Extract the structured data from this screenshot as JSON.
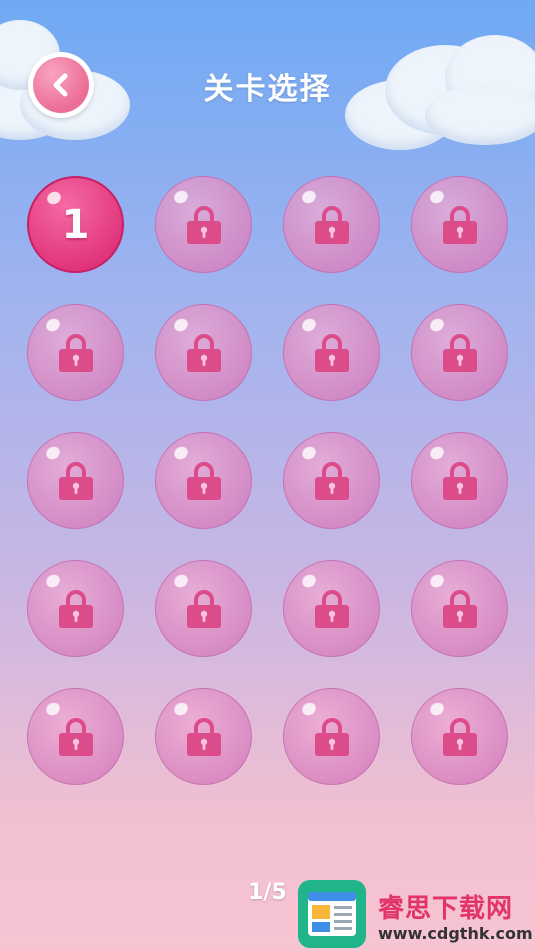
{
  "header": {
    "title": "关卡选择",
    "back_icon": "chevron-left-icon"
  },
  "levels": [
    {
      "label": "1",
      "state": "unlocked"
    },
    {
      "label": "",
      "state": "locked"
    },
    {
      "label": "",
      "state": "locked"
    },
    {
      "label": "",
      "state": "locked"
    },
    {
      "label": "",
      "state": "locked"
    },
    {
      "label": "",
      "state": "locked"
    },
    {
      "label": "",
      "state": "locked"
    },
    {
      "label": "",
      "state": "locked"
    },
    {
      "label": "",
      "state": "locked"
    },
    {
      "label": "",
      "state": "locked"
    },
    {
      "label": "",
      "state": "locked"
    },
    {
      "label": "",
      "state": "locked"
    },
    {
      "label": "",
      "state": "locked"
    },
    {
      "label": "",
      "state": "locked"
    },
    {
      "label": "",
      "state": "locked"
    },
    {
      "label": "",
      "state": "locked"
    },
    {
      "label": "",
      "state": "locked"
    },
    {
      "label": "",
      "state": "locked"
    },
    {
      "label": "",
      "state": "locked"
    },
    {
      "label": "",
      "state": "locked"
    }
  ],
  "pagination": {
    "text": "1/5"
  },
  "watermark": {
    "brand": "睿思下载网",
    "url": "www.cdgthk.com"
  },
  "colors": {
    "unlocked": "#e0337a",
    "locked_bubble": "#d682be",
    "lock": "#dc4b8a",
    "back_button": "#ec6d96"
  }
}
